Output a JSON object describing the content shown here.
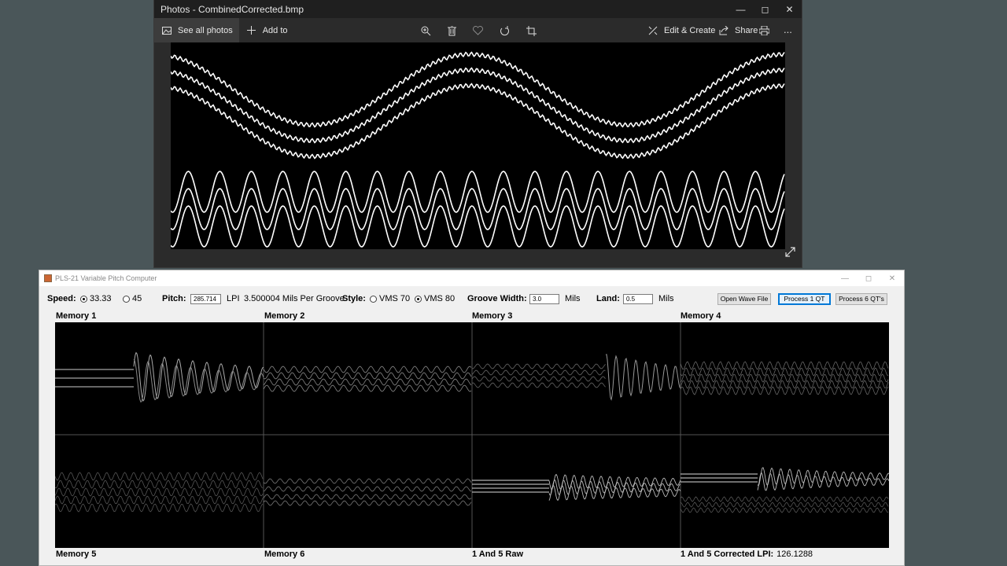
{
  "photos": {
    "title": "Photos - CombinedCorrected.bmp",
    "toolbar": {
      "see_all": "See all photos",
      "add_to": "Add to",
      "edit_create": "Edit & Create",
      "share": "Share",
      "more": "..."
    },
    "icons": [
      "photos-icon",
      "plus-icon",
      "zoom-icon",
      "delete-icon",
      "heart-icon",
      "rotate-icon",
      "crop-icon",
      "edit-icon",
      "share-icon",
      "print-icon",
      "more-icon",
      "expand-icon"
    ]
  },
  "pls": {
    "title": "PLS-21 Variable Pitch Computer",
    "speed_label": "Speed:",
    "speed_opt1": "33.33",
    "speed_opt2": "45",
    "pitch_label": "Pitch:",
    "pitch_value": "285.714",
    "lpi_unit": "LPI",
    "mils_per_groove": "3.500004 Mils Per Groove",
    "style_label": "Style:",
    "style_opt1": "VMS 70",
    "style_opt2": "VMS 80",
    "groove_width_label": "Groove Width:",
    "groove_width_value": "3.0",
    "mils1": "Mils",
    "land_label": "Land:",
    "land_value": "0.5",
    "mils2": "Mils",
    "open_wave": "Open Wave File",
    "process1": "Process 1 QT",
    "process6": "Process 6 QT's",
    "memory1": "Memory 1",
    "memory2": "Memory 2",
    "memory3": "Memory 3",
    "memory4": "Memory 4",
    "memory5": "Memory 5",
    "memory6": "Memory 6",
    "raw": "1 And 5 Raw",
    "corrected_label": "1 And 5 Corrected LPI:",
    "corrected_value": "126.1288"
  }
}
